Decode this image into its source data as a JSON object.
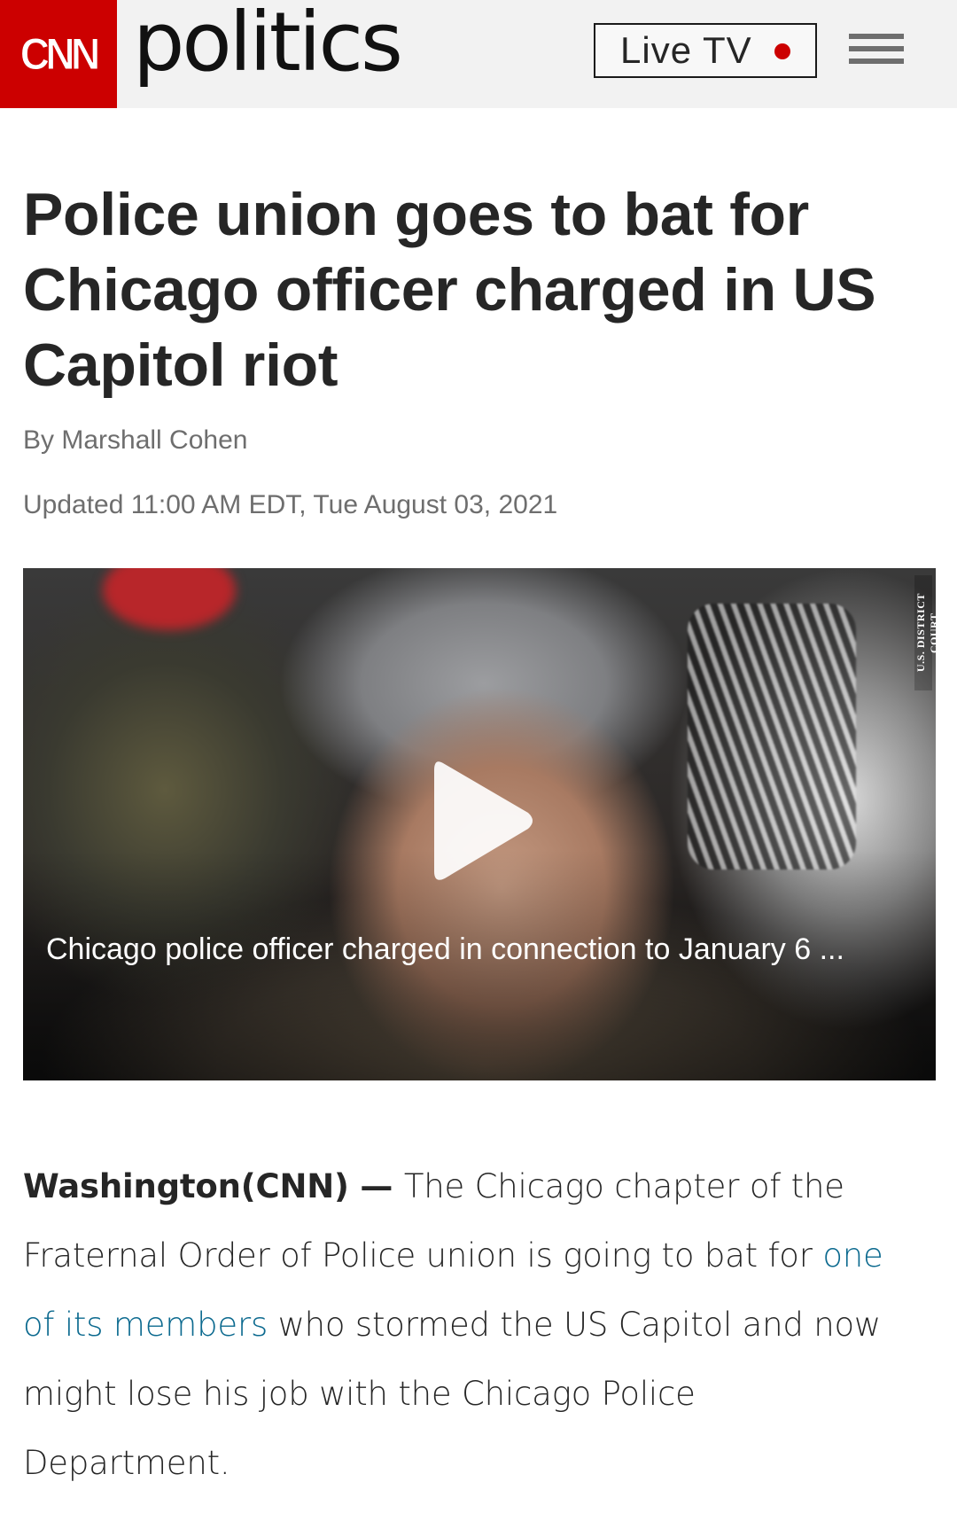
{
  "header": {
    "logo": "CNN",
    "section": "politics",
    "live_tv_label": "Live TV",
    "live_indicator_color": "#cc0000",
    "menu_icon": "hamburger-menu-icon"
  },
  "article": {
    "headline": "Police union goes to bat for Chicago officer charged in US Capitol riot",
    "byline_prefix": "By",
    "author": "Marshall Cohen",
    "updated": "Updated 11:00 AM EDT, Tue August 03, 2021"
  },
  "video": {
    "caption": "Chicago police officer charged in connection to January 6 ...",
    "credit": "U.S. DISTRICT COURT",
    "play_icon": "play-icon"
  },
  "body": {
    "dateline": "Washington(CNN)",
    "dash": " — ",
    "text_1": "The Chicago chapter of the Fraternal Order of Police union is going to bat for ",
    "link_text": "one of its members",
    "text_2": " who stormed the US Capitol and now might lose his job with the Chicago Police Department."
  },
  "colors": {
    "brand_red": "#cc0000",
    "link_blue": "#0c6a8f",
    "header_bg": "#f2f2f2"
  }
}
